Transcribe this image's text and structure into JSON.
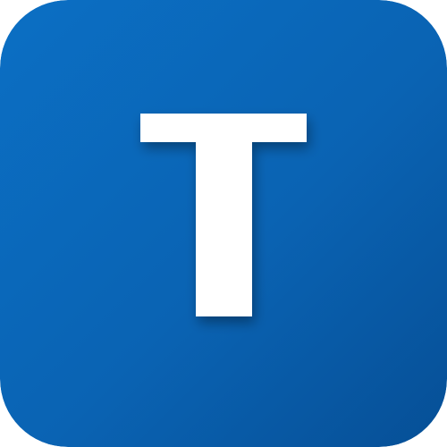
{
  "icon": {
    "name": "letter-t-app-icon",
    "letter": "T",
    "colors": {
      "background_top": "#0b6fc4",
      "background_mid": "#0a63b3",
      "background_bottom": "#064f96",
      "glyph": "#ffffff",
      "shadow": "#03386e"
    }
  }
}
